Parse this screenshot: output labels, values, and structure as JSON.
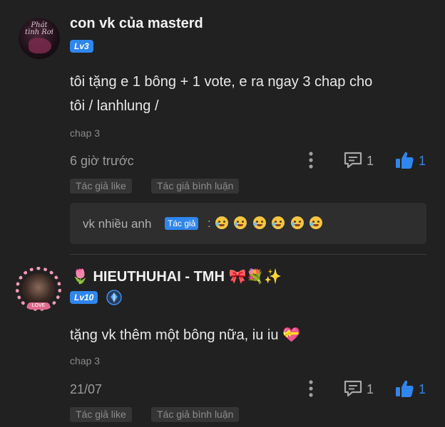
{
  "comments": [
    {
      "username": "con vk của masterd",
      "level": "Lv3",
      "content_line1": "tôi tặng e 1 bông + 1 vote, e ra ngay 3 chap cho",
      "content_line2": "tôi / lanhlung /",
      "chapter": "chap 3",
      "time": "6 giờ trước",
      "reply_count": "1",
      "like_count": "1",
      "tags": [
        "Tác giả like",
        "Tác giả bình luận"
      ],
      "reply": {
        "author": "vk nhiều anh",
        "author_badge": "Tác giả",
        "separator": ":",
        "emoji_count": "6",
        "emoji_icon": "crying-face-emoji"
      }
    },
    {
      "username_prefix_emoji": "🌷",
      "username": "HIEUTHUHAI - TMH",
      "username_suffix_emoji": "🎀💐✨",
      "level": "Lv10",
      "avatar_tag": "LOVE",
      "content": "tặng vk thêm một bông nữa, iu iu",
      "content_emoji": "💝",
      "chapter": "chap 3",
      "time": "21/07",
      "reply_count": "1",
      "like_count": "1",
      "tags": [
        "Tác giả like",
        "Tác giả bình luận"
      ]
    }
  ],
  "avatar1_text": "Phát tình Rơi",
  "colors": {
    "background": "#212121",
    "accent_blue": "#2f86ee",
    "tag_bg": "#353535",
    "reply_bg": "#2e2e2e"
  },
  "icons": [
    "more-vert-icon",
    "reply-comment-icon",
    "thumbs-up-icon",
    "diamond-badge-icon"
  ]
}
